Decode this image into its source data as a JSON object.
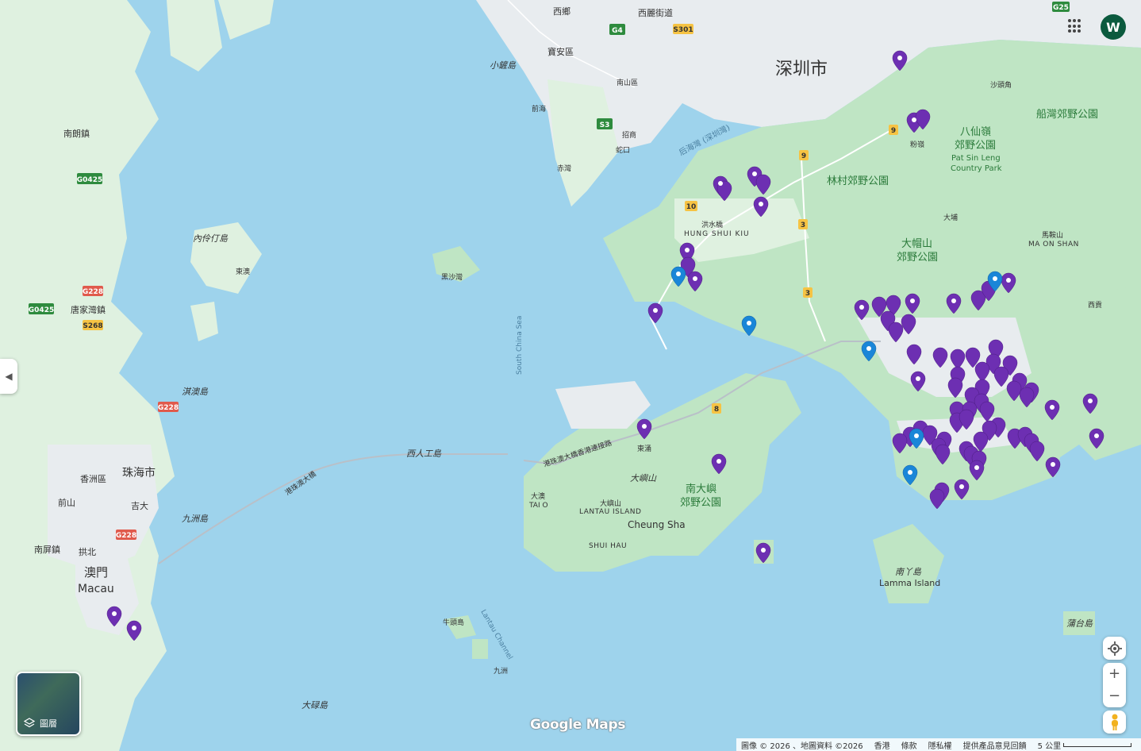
{
  "map": {
    "labels": {
      "shenzhen": "深圳市",
      "zhuhai": "珠海市",
      "macau_zh": "澳門",
      "macau_en": "Macau",
      "hung_shui_kiu_zh": "洪水橋",
      "hung_shui_kiu_en": "HUNG SHUI KIU",
      "lantau_zh": "大嶼山",
      "lantau_en": "LANTAU ISLAND",
      "lantau_italic": "大嶼山",
      "tai_o_zh": "大澳",
      "tai_o_en": "TAI O",
      "cheung_sha": "Cheung Sha",
      "shui_hau": "SHUI HAU",
      "south_lantau_park_1": "南大嶼",
      "south_lantau_park_2": "郊野公園",
      "tai_lam_park": "林村郊野公園",
      "tai_mo_shan_1": "大帽山",
      "tai_mo_shan_2": "郊野公園",
      "pat_sin_leng_1": "八仙嶺",
      "pat_sin_leng_2": "郊野公園",
      "pat_sin_leng_3": "Pat Sin Leng",
      "pat_sin_leng_4": "Country Park",
      "ma_on_shan_zh": "馬鞍山",
      "ma_on_shan_en": "MA ON SHAN",
      "sai_kung_park": "船灣郊野公園",
      "lamma_zh": "南丫島",
      "lamma_en": "Lamma Island",
      "tung_chung": "東涌",
      "south_china_sea": "South China Sea",
      "lantau_channel": "Lantau Channel",
      "hkzm_bridge": "港珠澳大橋香港連接路",
      "hkzm_bridge_2": "港珠澳大橋",
      "artificial_island": "西人工島",
      "shenzhen_bay": "后海灣 (深圳灣)",
      "xixiang": "西鄉",
      "xili": "西麗街道",
      "baoan": "寶安區",
      "nanshan": "南山區",
      "nanlang": "南朗鎮",
      "tangjiawan": "唐家灣鎮",
      "xiangzhou": "香洲區",
      "qianshan": "前山",
      "jida": "吉大",
      "gongbei": "拱北",
      "nanping": "南屏鎮",
      "jiuzhou": "九洲島",
      "qi_ao": "淇澳島",
      "neilingding": "內伶仃島",
      "heishawan": "黑沙灣",
      "dalu": "大碌島",
      "zhuzhou": "九洲",
      "fanling": "粉嶺",
      "taipo": "大埔",
      "sai_kung": "西貢",
      "sha_tau_kok": "沙頭角",
      "po_toi": "蒲台島",
      "xiao_chan": "小鏟島",
      "niutou": "牛頭島",
      "jiuzhou_island": "九洲",
      "donghuang": "東澳",
      "shekou": "蛇口",
      "chiwan": "赤灣",
      "zhaoshang": "招商",
      "qianhai": "前海"
    },
    "road_shields": {
      "g4": "G4",
      "s301": "S301",
      "s3": "S3",
      "g0425_a": "G0425",
      "g0425_b": "G0425",
      "g228_a": "G228",
      "g228_b": "G228",
      "g228_c": "G228",
      "s268": "S268",
      "g25": "G25",
      "r9_a": "9",
      "r9_b": "9",
      "r3_a": "3",
      "r3_b": "3",
      "r10": "10",
      "r8": "8"
    }
  },
  "controls": {
    "layers_label": "圖層",
    "avatar_initial": "W",
    "zoom_in": "+",
    "zoom_out": "−",
    "collapse": "◀"
  },
  "logo": {
    "text": "Google Maps"
  },
  "footer": {
    "imagery": "圖像 © 2026 、地圖資料 ©2026",
    "region": "香港",
    "terms": "條款",
    "privacy": "隱私權",
    "feedback": "提供產品意見回饋",
    "scale": "5 公里"
  },
  "colors": {
    "water": "#9ed3ec",
    "land": "#dff1e0",
    "urban": "#e8ecef",
    "park": "#bfe5c4",
    "pin_purple": "#6d2fb2",
    "pin_blue": "#1a86d8"
  }
}
